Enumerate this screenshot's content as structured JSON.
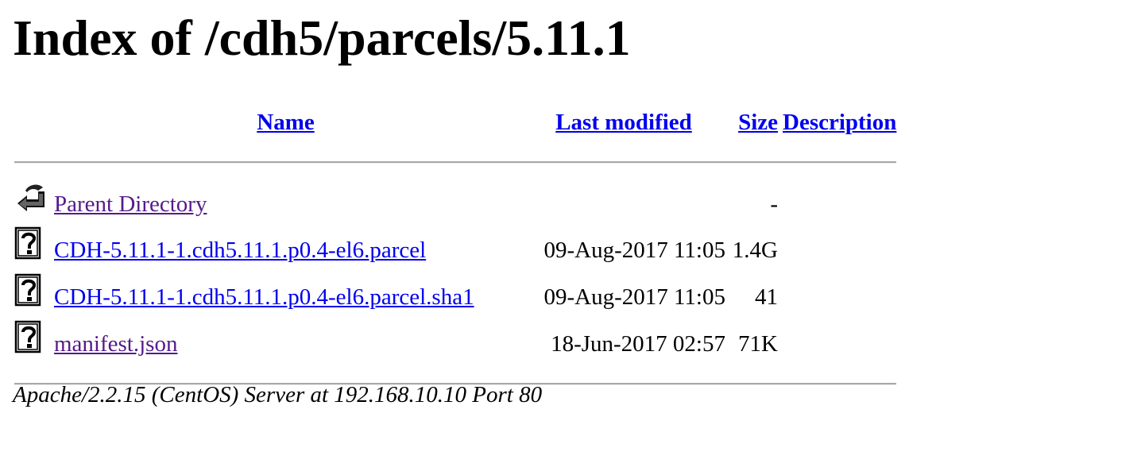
{
  "page": {
    "heading": "Index of /cdh5/parcels/5.11.1"
  },
  "table": {
    "headers": {
      "name": "Name",
      "last_modified": "Last modified",
      "size": "Size",
      "description": "Description"
    },
    "rows": [
      {
        "icon": "back-arrow-icon",
        "name": "Parent Directory",
        "modified": "",
        "size": "-",
        "description": "",
        "visited": true
      },
      {
        "icon": "unknown-file-icon",
        "name": "CDH-5.11.1-1.cdh5.11.1.p0.4-el6.parcel",
        "modified": "09-Aug-2017 11:05",
        "size": "1.4G",
        "description": "",
        "visited": false
      },
      {
        "icon": "unknown-file-icon",
        "name": "CDH-5.11.1-1.cdh5.11.1.p0.4-el6.parcel.sha1",
        "modified": "09-Aug-2017 11:05",
        "size": "41",
        "description": "",
        "visited": false
      },
      {
        "icon": "unknown-file-icon",
        "name": "manifest.json",
        "modified": "18-Jun-2017 02:57",
        "size": "71K",
        "description": "",
        "visited": true
      }
    ]
  },
  "footer": {
    "text": "Apache/2.2.15 (CentOS) Server at 192.168.10.10 Port 80"
  },
  "colors": {
    "link": "#0000ee",
    "visited": "#551a8b",
    "rule": "#a8a8a8"
  }
}
